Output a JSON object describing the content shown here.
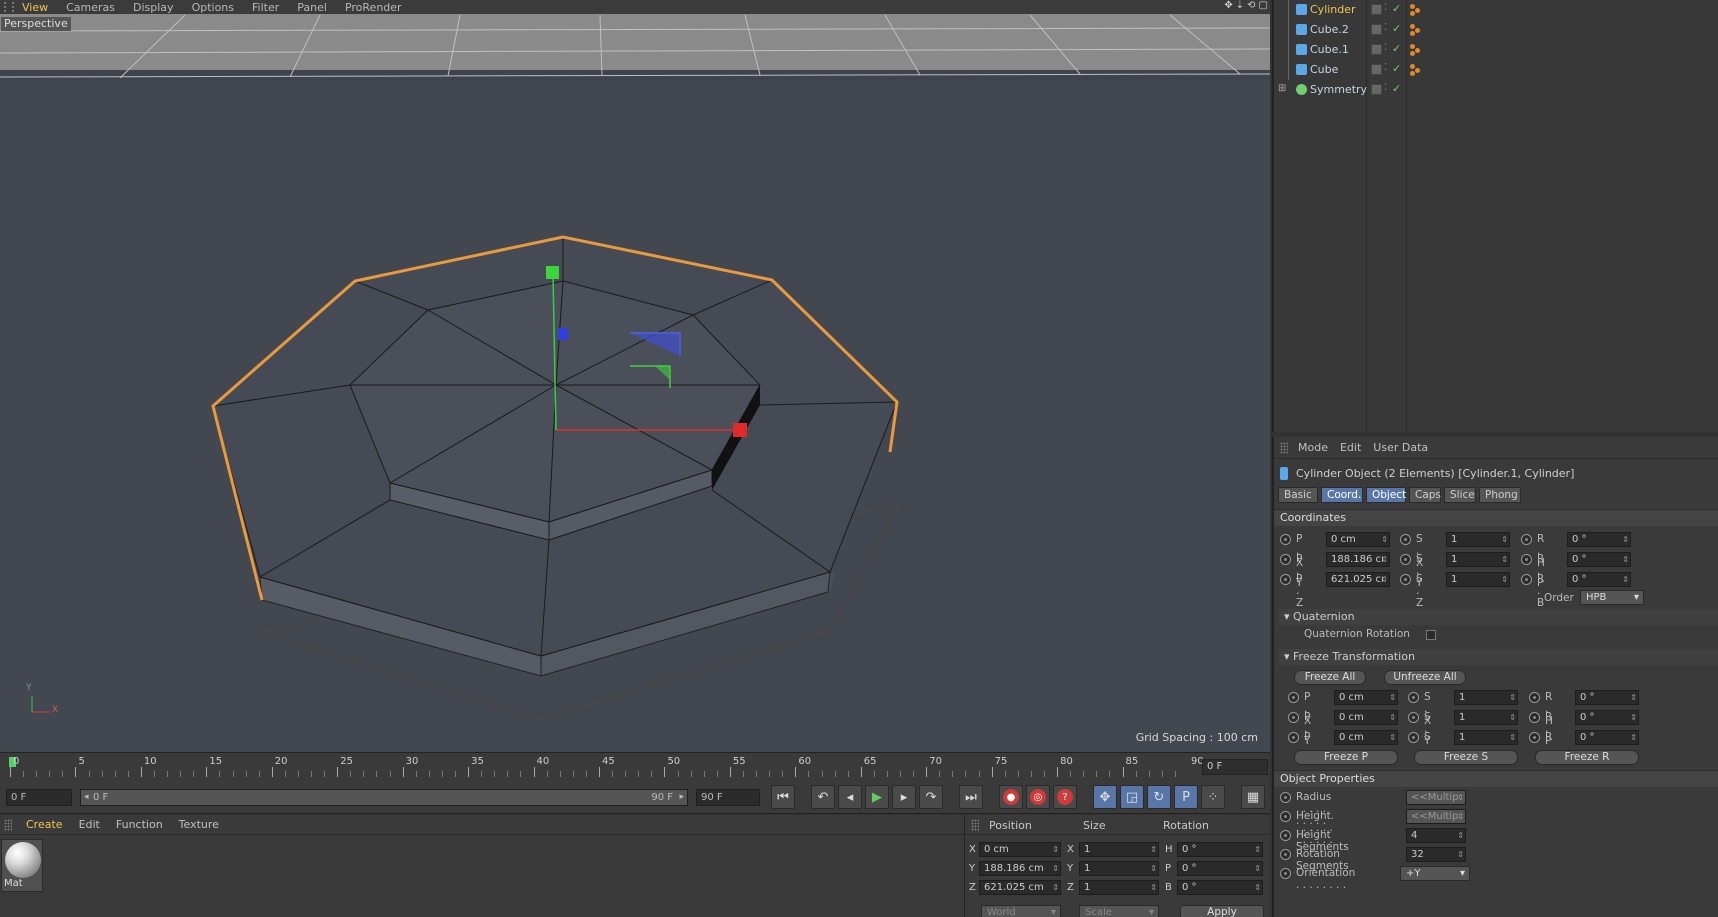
{
  "viewport": {
    "menus": [
      "View",
      "Cameras",
      "Display",
      "Options",
      "Filter",
      "Panel",
      "ProRender"
    ],
    "active_menu": "View",
    "camera_label": "Perspective",
    "grid_spacing": "Grid Spacing : 100 cm",
    "axis_y": "Y",
    "axis_x": "X",
    "nav_icons": [
      "move-camera-icon",
      "zoom-camera-icon",
      "rotate-camera-icon",
      "maximize-view-icon"
    ]
  },
  "timeline": {
    "ticks": [
      "0",
      "5",
      "10",
      "15",
      "20",
      "25",
      "30",
      "35",
      "40",
      "45",
      "50",
      "55",
      "60",
      "65",
      "70",
      "75",
      "80",
      "85",
      "90"
    ],
    "current_frame": "0 F"
  },
  "transport": {
    "start_frame": "0 F",
    "range_start": "0 F",
    "range_end": "90 F",
    "end_frame": "90 F"
  },
  "materials": {
    "menus": [
      "Create",
      "Edit",
      "Function",
      "Texture"
    ],
    "active_menu": "Create",
    "items": [
      {
        "name": "Mat"
      }
    ]
  },
  "coordinates": {
    "headers": [
      "Position",
      "Size",
      "Rotation"
    ],
    "rows": [
      {
        "axis": "X",
        "pos": "0 cm",
        "size_axis": "X",
        "size": "1",
        "rot_axis": "H",
        "rot": "0 °"
      },
      {
        "axis": "Y",
        "pos": "188.186 cm",
        "size_axis": "Y",
        "size": "1",
        "rot_axis": "P",
        "rot": "0 °"
      },
      {
        "axis": "Z",
        "pos": "621.025 cm",
        "size_axis": "Z",
        "size": "1",
        "rot_axis": "B",
        "rot": "0 °"
      }
    ],
    "space": "World",
    "mode": "Scale",
    "apply": "Apply"
  },
  "objects": {
    "items": [
      {
        "name": "Cylinder",
        "selected": true,
        "icon_color": "#5aa8e8",
        "has_tag": true
      },
      {
        "name": "Cube.2",
        "selected": false,
        "icon_color": "#5aa8e8",
        "has_tag": true
      },
      {
        "name": "Cube.1",
        "selected": false,
        "icon_color": "#5aa8e8",
        "has_tag": true
      },
      {
        "name": "Cube",
        "selected": false,
        "icon_color": "#5aa8e8",
        "has_tag": true
      },
      {
        "name": "Symmetry",
        "selected": false,
        "icon_color": "#6fd06f",
        "has_tag": false
      }
    ]
  },
  "attributes": {
    "menus": [
      "Mode",
      "Edit",
      "User Data"
    ],
    "title": "Cylinder Object (2 Elements) [Cylinder.1, Cylinder]",
    "tabs": [
      "Basic",
      "Coord.",
      "Object",
      "Caps",
      "Slice",
      "Phong"
    ],
    "active_tabs": [
      "Coord.",
      "Object"
    ],
    "coordinates_header": "Coordinates",
    "coord_rows": [
      {
        "p_label": "P . X",
        "p": "0 cm",
        "s_label": "S . X",
        "s": "1",
        "r_label": "R . H",
        "r": "0 °"
      },
      {
        "p_label": "P . Y",
        "p": "188.186 cı",
        "s_label": "S . Y",
        "s": "1",
        "r_label": "R . P",
        "r": "0 °"
      },
      {
        "p_label": "P . Z",
        "p": "621.025 cı",
        "s_label": "S . Z",
        "s": "1",
        "r_label": "R . B",
        "r": "0 °"
      }
    ],
    "order_label": "Order",
    "order_value": "HPB",
    "quaternion_header": "Quaternion",
    "quaternion_rotation": "Quaternion Rotation",
    "freeze_header": "Freeze Transformation",
    "freeze_all": "Freeze All",
    "unfreeze_all": "Unfreeze All",
    "freeze_rows": [
      {
        "p_label": "P . X",
        "p": "0 cm",
        "s_label": "S . X",
        "s": "1",
        "r_label": "R . H",
        "r": "0 °"
      },
      {
        "p_label": "P . Y",
        "p": "0 cm",
        "s_label": "S . Y",
        "s": "1",
        "r_label": "R . P",
        "r": "0 °"
      },
      {
        "p_label": "P . Z",
        "p": "0 cm",
        "s_label": "S . Z",
        "s": "1",
        "r_label": "R . B",
        "r": "0 °"
      }
    ],
    "freeze_p": "Freeze P",
    "freeze_s": "Freeze S",
    "freeze_r": "Freeze R",
    "object_props_header": "Object Properties",
    "props": [
      {
        "label": "Radius . . . . . . . . . . . .",
        "value": "<<Multip"
      },
      {
        "label": "Height. . . . . . . . . . . . .",
        "value": "<<Multip"
      },
      {
        "label": "Height Segments",
        "value": "4"
      },
      {
        "label": "Rotation Segments",
        "value": "32"
      },
      {
        "label": "Orientation . . . . . . . .",
        "value": "+Y"
      }
    ]
  }
}
